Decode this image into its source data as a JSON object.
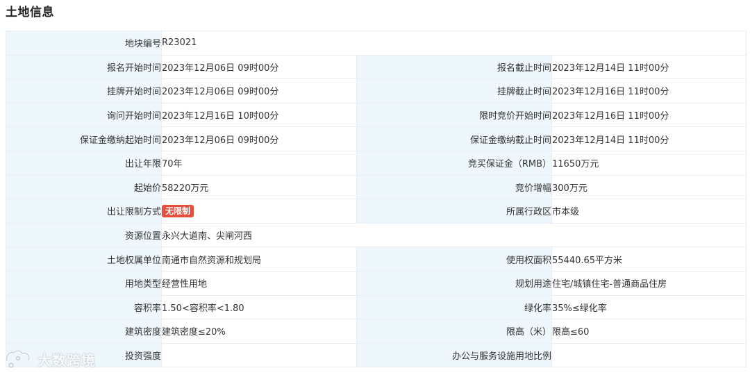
{
  "section": {
    "title": "土地信息"
  },
  "rows": [
    {
      "cells": [
        {
          "label": "地块编号",
          "value": "R23021",
          "span": true
        }
      ]
    },
    {
      "cells": [
        {
          "label": "报名开始时间",
          "value": "2023年12月06日 09时00分"
        },
        {
          "label": "报名截止时间",
          "value": "2023年12月14日 11时00分"
        }
      ]
    },
    {
      "cells": [
        {
          "label": "挂牌开始时间",
          "value": "2023年12月06日 09时00分"
        },
        {
          "label": "挂牌截止时间",
          "value": "2023年12月16日 11时00分"
        }
      ]
    },
    {
      "cells": [
        {
          "label": "询问开始时间",
          "value": "2023年12月16日 10时00分"
        },
        {
          "label": "限时竞价开始时间",
          "value": "2023年12月16日 11时00分"
        }
      ]
    },
    {
      "cells": [
        {
          "label": "保证金缴纳起始时间",
          "value": "2023年12月06日 09时00分"
        },
        {
          "label": "保证金缴纳截止时间",
          "value": "2023年12月14日 11时00分"
        }
      ]
    },
    {
      "cells": [
        {
          "label": "出让年限",
          "value": "70年"
        },
        {
          "label": "竞买保证金（RMB）",
          "value": "11650万元"
        }
      ]
    },
    {
      "cells": [
        {
          "label": "起始价",
          "value": "58220万元"
        },
        {
          "label": "竞价增幅",
          "value": "300万元"
        }
      ]
    },
    {
      "cells": [
        {
          "label": "出让限制方式",
          "value": "无限制",
          "badge": true,
          "badge_color": "#e54e3c"
        },
        {
          "label": "所属行政区",
          "value": "市本级"
        }
      ]
    },
    {
      "cells": [
        {
          "label": "资源位置",
          "value": "永兴大道南、尖闸河西",
          "span": true
        }
      ]
    },
    {
      "cells": [
        {
          "label": "土地权属单位",
          "value": "南通市自然资源和规划局"
        },
        {
          "label": "使用权面积",
          "value": "55440.65平方米"
        }
      ]
    },
    {
      "cells": [
        {
          "label": "用地类型",
          "value": "经营性用地"
        },
        {
          "label": "规划用途",
          "value": "住宅/城镇住宅-普通商品住房"
        }
      ]
    },
    {
      "cells": [
        {
          "label": "容积率",
          "value": "1.50<容积率<1.80"
        },
        {
          "label": "绿化率",
          "value": "35%≤绿化率"
        }
      ]
    },
    {
      "cells": [
        {
          "label": "建筑密度",
          "value": "建筑密度≤20%"
        },
        {
          "label": "限高（米）",
          "value": "限高≤60"
        }
      ]
    },
    {
      "cells": [
        {
          "label": "投资强度",
          "value": ""
        },
        {
          "label": "办公与服务设施用地比例",
          "value": ""
        }
      ]
    }
  ],
  "watermark": {
    "text": "大数跨境",
    "icon": "brand-logo-icon"
  },
  "colors": {
    "label_bg": "#eef7fc",
    "border": "#e8eef3",
    "badge": "#e54e3c"
  }
}
